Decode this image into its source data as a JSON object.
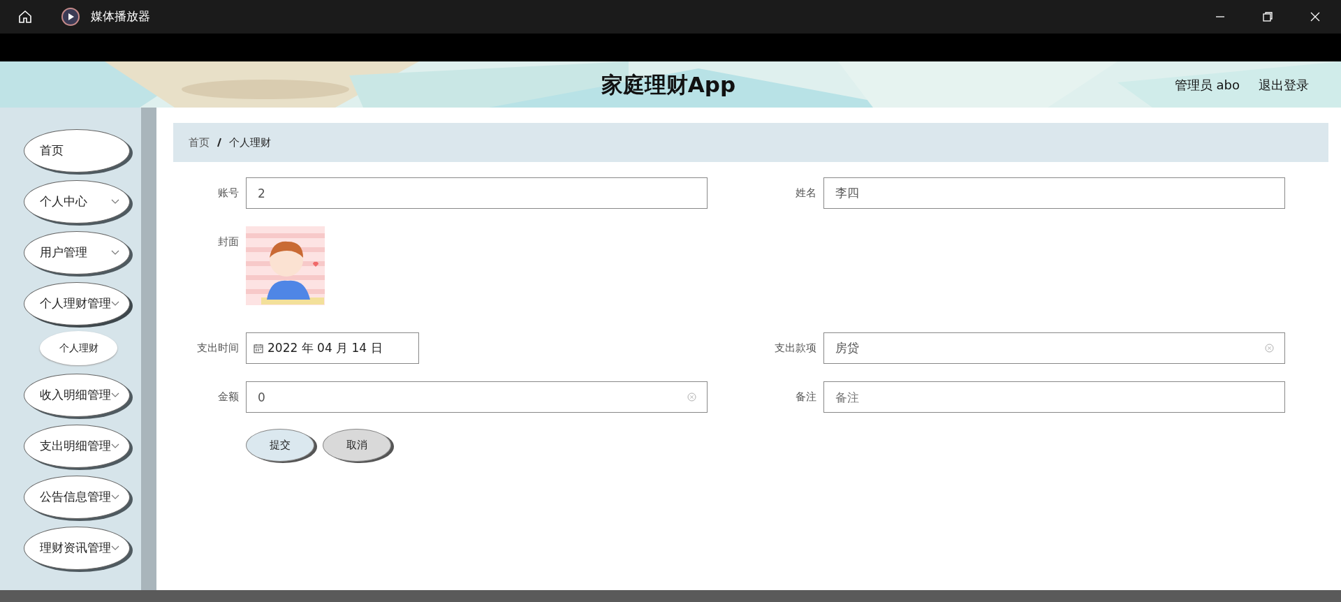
{
  "window": {
    "title": "媒体播放器"
  },
  "header": {
    "title": "家庭理财App",
    "user": "管理员 abo",
    "logout": "退出登录"
  },
  "sidebar": {
    "items": [
      {
        "label": "首页",
        "caret": false,
        "expanded": false
      },
      {
        "label": "个人中心",
        "caret": true,
        "expanded": false
      },
      {
        "label": "用户管理",
        "caret": true,
        "expanded": false
      },
      {
        "label": "个人理财管理",
        "caret": true,
        "expanded": true,
        "children": [
          {
            "label": "个人理财"
          }
        ]
      },
      {
        "label": "收入明细管理",
        "caret": true,
        "expanded": false
      },
      {
        "label": "支出明细管理",
        "caret": true,
        "expanded": false
      },
      {
        "label": "公告信息管理",
        "caret": true,
        "expanded": false
      },
      {
        "label": "理财资讯管理",
        "caret": true,
        "expanded": false
      }
    ]
  },
  "breadcrumb": [
    "首页",
    "个人理财"
  ],
  "form": {
    "rows": [
      [
        {
          "kind": "text",
          "label": "账号",
          "value": "2",
          "clearable": false
        },
        {
          "kind": "text",
          "label": "姓名",
          "value": "李四",
          "clearable": false
        }
      ],
      [
        {
          "label": "封面"
        }
      ],
      [
        {
          "kind": "date",
          "label": "支出时间",
          "value": "2022 年 04 月 14 日"
        },
        {
          "kind": "text",
          "label": "支出款项",
          "value": "房贷",
          "clearable": true
        }
      ],
      [
        {
          "kind": "text",
          "label": "金额",
          "value": "0",
          "clearable": true
        },
        {
          "kind": "text",
          "label": "备注",
          "placeholder": "备注",
          "clearable": false
        }
      ]
    ],
    "buttons": [
      {
        "label": "提交",
        "kind": "primary"
      },
      {
        "label": "取消",
        "kind": "secondary"
      }
    ]
  }
}
